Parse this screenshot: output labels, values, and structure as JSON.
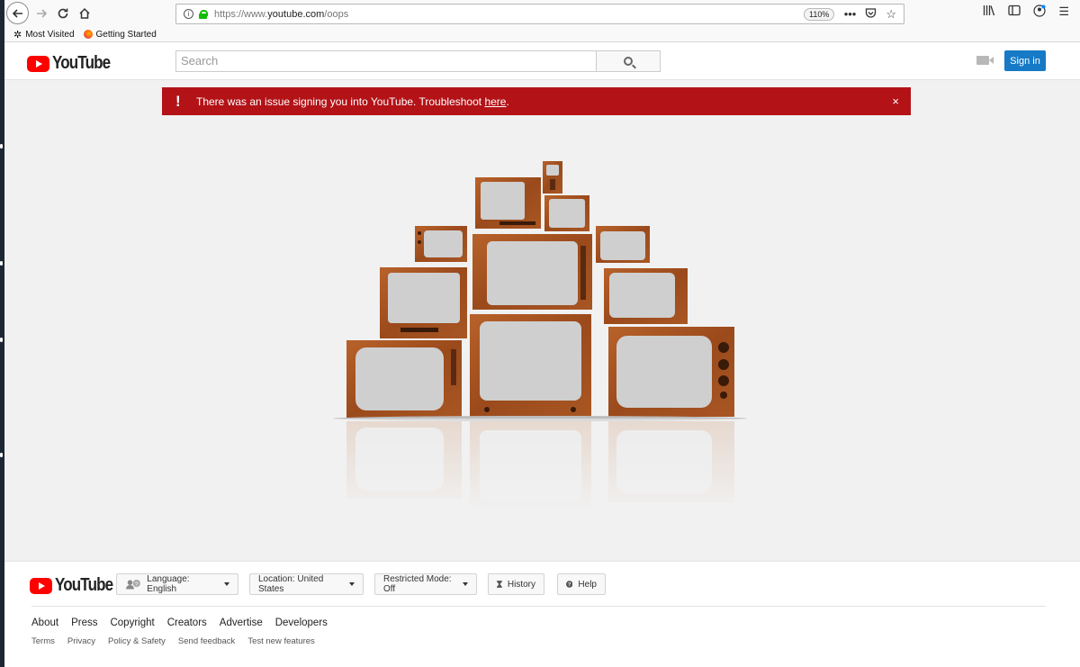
{
  "browser": {
    "url_prefix": "https://www.",
    "url_domain": "youtube.com",
    "url_path": "/oops",
    "zoom": "110%",
    "bookmarks": [
      "Most Visited",
      "Getting Started"
    ]
  },
  "masthead": {
    "logo_text": "YouTube",
    "search_placeholder": "Search",
    "signin_label": "Sign in"
  },
  "error_banner": {
    "icon": "!",
    "message": "There was an issue signing you into YouTube. Troubleshoot ",
    "link_text": "here",
    "suffix": ".",
    "close": "×",
    "color": "#b31217"
  },
  "footer": {
    "logo_text": "YouTube",
    "language_label": "Language: English",
    "location_label": "Location: United States",
    "restricted_label": "Restricted Mode: ",
    "restricted_value": "Off",
    "history_label": "History",
    "help_label": "Help",
    "links_primary": [
      "About",
      "Press",
      "Copyright",
      "Creators",
      "Advertise",
      "Developers"
    ],
    "links_secondary": [
      "Terms",
      "Privacy",
      "Policy & Safety",
      "Send feedback",
      "Test new features"
    ]
  }
}
